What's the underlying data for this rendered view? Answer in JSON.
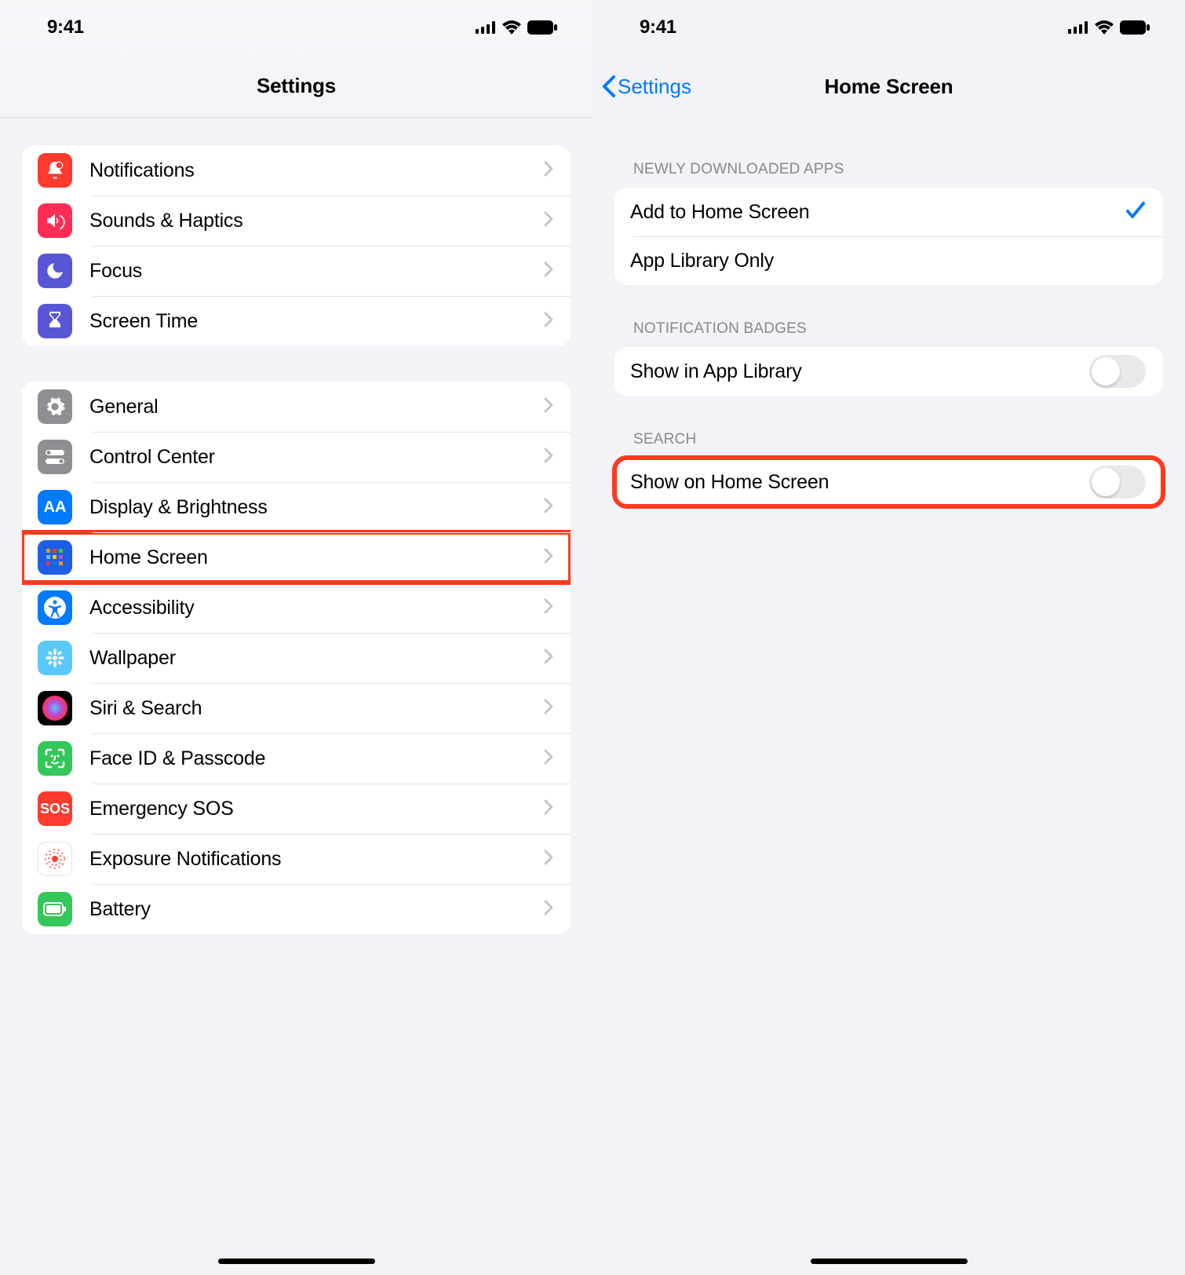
{
  "status": {
    "time": "9:41"
  },
  "left": {
    "title": "Settings",
    "groups": [
      {
        "rows": [
          {
            "label": "Notifications",
            "iconClass": "ic-red",
            "glyph": "bell"
          },
          {
            "label": "Sounds & Haptics",
            "iconClass": "ic-pink",
            "glyph": "speaker"
          },
          {
            "label": "Focus",
            "iconClass": "ic-indigo",
            "glyph": "moon"
          },
          {
            "label": "Screen Time",
            "iconClass": "ic-indigo",
            "glyph": "hourglass"
          }
        ]
      },
      {
        "rows": [
          {
            "label": "General",
            "iconClass": "ic-gray",
            "glyph": "gear"
          },
          {
            "label": "Control Center",
            "iconClass": "ic-gray",
            "glyph": "switches"
          },
          {
            "label": "Display & Brightness",
            "iconClass": "ic-blue",
            "glyph": "aa"
          },
          {
            "label": "Home Screen",
            "iconClass": "ic-blue-dark",
            "glyph": "grid",
            "highlight": true
          },
          {
            "label": "Accessibility",
            "iconClass": "ic-blue",
            "glyph": "accessibility"
          },
          {
            "label": "Wallpaper",
            "iconClass": "ic-teal",
            "glyph": "flower"
          },
          {
            "label": "Siri & Search",
            "iconClass": "ic-black",
            "glyph": "siri"
          },
          {
            "label": "Face ID & Passcode",
            "iconClass": "ic-green",
            "glyph": "faceid"
          },
          {
            "label": "Emergency SOS",
            "iconClass": "ic-red",
            "glyph": "sos"
          },
          {
            "label": "Exposure Notifications",
            "iconClass": "ic-white",
            "glyph": "exposure"
          },
          {
            "label": "Battery",
            "iconClass": "ic-green",
            "glyph": "battery"
          }
        ]
      }
    ]
  },
  "right": {
    "back": "Settings",
    "title": "Home Screen",
    "sections": [
      {
        "header": "NEWLY DOWNLOADED APPS",
        "rows": [
          {
            "label": "Add to Home Screen",
            "checked": true
          },
          {
            "label": "App Library Only",
            "checked": false
          }
        ]
      },
      {
        "header": "NOTIFICATION BADGES",
        "rows": [
          {
            "label": "Show in App Library",
            "toggle": false
          }
        ]
      },
      {
        "header": "SEARCH",
        "highlight": true,
        "rows": [
          {
            "label": "Show on Home Screen",
            "toggle": false
          }
        ]
      }
    ]
  }
}
